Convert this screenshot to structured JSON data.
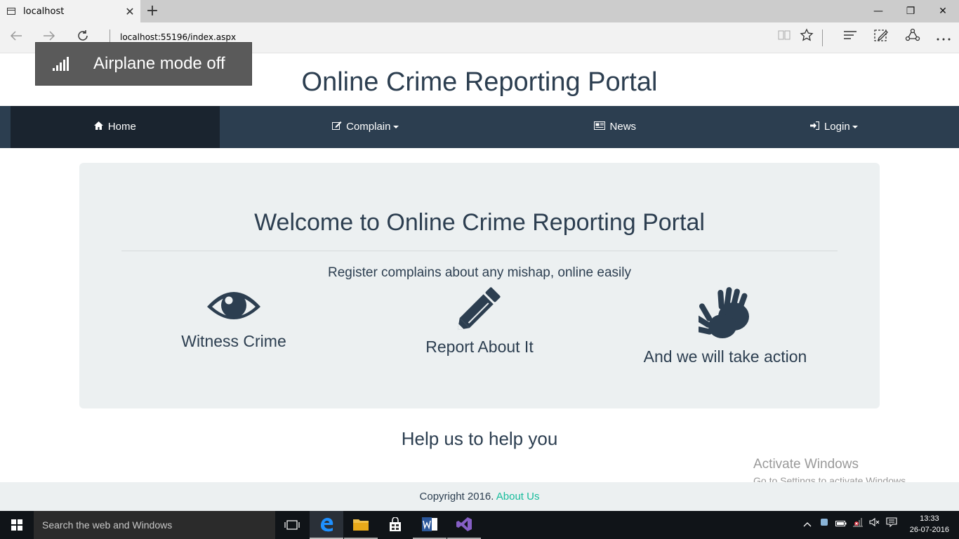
{
  "browser": {
    "tab_title": "localhost",
    "tab_close": "✕",
    "new_tab": "+",
    "url": "localhost:55196/index.aspx",
    "minimize": "—",
    "restore": "❐",
    "close": "✕"
  },
  "toast": {
    "text": "Airplane mode off"
  },
  "site": {
    "title": "Online Crime Reporting Portal"
  },
  "navbar": {
    "items": [
      {
        "label": "Home",
        "icon": "home-icon"
      },
      {
        "label": "Complain",
        "icon": "edit-icon"
      },
      {
        "label": "News",
        "icon": "newspaper-icon"
      },
      {
        "label": "Login",
        "icon": "sign-in-icon"
      }
    ]
  },
  "jumbotron": {
    "title": "Welcome to Online Crime Reporting Portal",
    "subtitle": "Register complains about any mishap, online easily",
    "features": [
      {
        "label": "Witness Crime",
        "icon": "eye-icon"
      },
      {
        "label": "Report About It",
        "icon": "pencil-icon"
      },
      {
        "label": "And we will take action",
        "icon": "hands-icon"
      }
    ]
  },
  "help_text": "Help us to help you",
  "watermark": {
    "line1": "Activate Windows",
    "line2": "Go to Settings to activate Windows."
  },
  "footer": {
    "text": "Copyright 2016.",
    "link": "About Us"
  },
  "taskbar": {
    "search_placeholder": "Search the web and Windows",
    "time": "13:33",
    "date": "26-07-2016"
  },
  "colors": {
    "primary": "#2c3e50",
    "active_nav": "#1a242f",
    "jumbotron_bg": "#ecf0f1",
    "link": "#18bc9c"
  }
}
